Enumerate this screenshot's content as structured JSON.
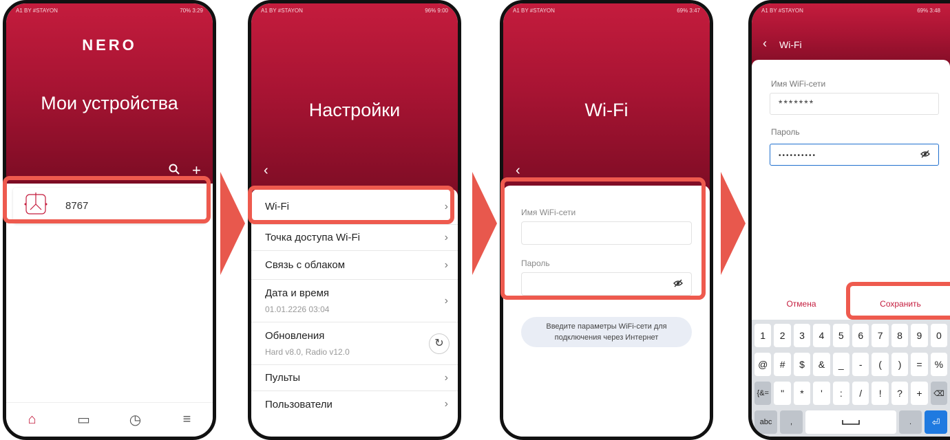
{
  "phone1": {
    "status_left": "A1 BY #STAYON",
    "status_right": "70% 3:29",
    "logo": "NERO",
    "title": "Мои устройства",
    "device_name": "8767"
  },
  "phone2": {
    "status_left": "A1 BY #STAYON",
    "status_right": "96% 9:00",
    "title": "Настройки",
    "items": [
      {
        "label": "Wi-Fi"
      },
      {
        "label": "Точка доступа Wi-Fi"
      },
      {
        "label": "Связь с облаком"
      },
      {
        "label": "Дата и время",
        "sub": "01.01.2226 03:04"
      },
      {
        "label": "Обновления",
        "sub": "Hard v8.0, Radio v12.0"
      },
      {
        "label": "Пульты"
      },
      {
        "label": "Пользователи"
      }
    ]
  },
  "phone3": {
    "status_left": "A1 BY #STAYON",
    "status_right": "69% 3:47",
    "title": "Wi-Fi",
    "ssid_label": "Имя WiFi-сети",
    "password_label": "Пароль",
    "info_text": "Введите параметры WiFi-сети для подключения через Интернет"
  },
  "phone4": {
    "status_left": "A1 BY #STAYON",
    "status_right": "69% 3:48",
    "header_title": "Wi-Fi",
    "ssid_label": "Имя WiFi-сети",
    "ssid_value": "*******",
    "password_label": "Пароль",
    "password_value": "••••••••••",
    "cancel_label": "Отмена",
    "save_label": "Сохранить",
    "keyboard": {
      "row1": [
        "1",
        "2",
        "3",
        "4",
        "5",
        "6",
        "7",
        "8",
        "9",
        "0"
      ],
      "row2": [
        "@",
        "#",
        "$",
        "&",
        "_",
        "-",
        "(",
        ")",
        "=",
        "%"
      ],
      "row3": [
        "{&=",
        "\"",
        "*",
        "'",
        ":",
        "/",
        "!",
        "?",
        "+",
        "⌫"
      ],
      "row4": [
        "abc",
        ",",
        "",
        ".",
        "⏎"
      ]
    }
  }
}
